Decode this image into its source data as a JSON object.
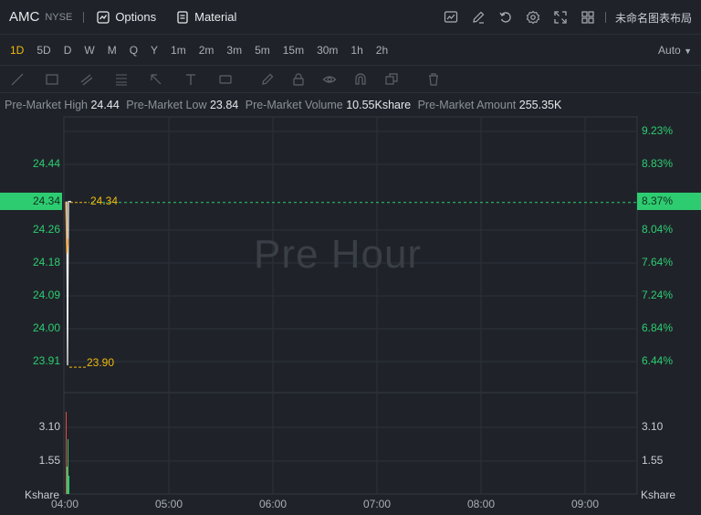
{
  "header": {
    "symbol": "AMC",
    "exchange": "NYSE",
    "options_label": "Options",
    "material_label": "Material",
    "layout_label": "未命名图表布局",
    "toolbar_icons": [
      "indicator-icon",
      "draw-icon",
      "undo-icon",
      "settings-icon",
      "fullscreen-icon",
      "layout-grid-icon"
    ]
  },
  "periods": {
    "items": [
      "1D",
      "5D",
      "D",
      "W",
      "M",
      "Q",
      "Y",
      "1m",
      "2m",
      "3m",
      "5m",
      "15m",
      "30m",
      "1h",
      "2h"
    ],
    "active": "1D",
    "scale_label": "Auto"
  },
  "stats": {
    "high_label": "Pre-Market High",
    "high_value": "24.44",
    "low_label": "Pre-Market Low",
    "low_value": "23.84",
    "volume_label": "Pre-Market Volume",
    "volume_value": "10.55Kshare",
    "amount_label": "Pre-Market Amount",
    "amount_value": "255.35K"
  },
  "chart": {
    "watermark": "Pre Hour",
    "price_ticks": [
      "24.44",
      "24.26",
      "24.18",
      "24.09",
      "24.00",
      "23.91"
    ],
    "pct_ticks": [
      "9.23%",
      "8.83%",
      "8.04%",
      "7.64%",
      "7.24%",
      "6.84%",
      "6.44%"
    ],
    "current_price": "24.34",
    "current_pct": "8.37%",
    "high_annotation": "24.34",
    "low_annotation": "23.90",
    "volume_ticks": [
      "3.10",
      "1.55"
    ],
    "volume_unit": "Kshare",
    "time_ticks": [
      "04:00",
      "05:00",
      "06:00",
      "07:00",
      "08:00",
      "09:00"
    ],
    "colors": {
      "up": "#2ecc71",
      "accent": "#f2b90d",
      "down": "#e74c3c",
      "line": "#ffffff",
      "avg": "#f2a33a"
    }
  },
  "chart_data": {
    "type": "line",
    "title": "",
    "x": [
      "04:00",
      "04:00",
      "04:00",
      "04:01"
    ],
    "series": [
      {
        "values": [
          24.34,
          23.9,
          24.34,
          24.34
        ]
      }
    ],
    "ylim": [
      23.84,
      24.5
    ],
    "xlabel": "",
    "ylabel": "",
    "volume": [
      3.6,
      1.2,
      2.4,
      0.8
    ]
  }
}
